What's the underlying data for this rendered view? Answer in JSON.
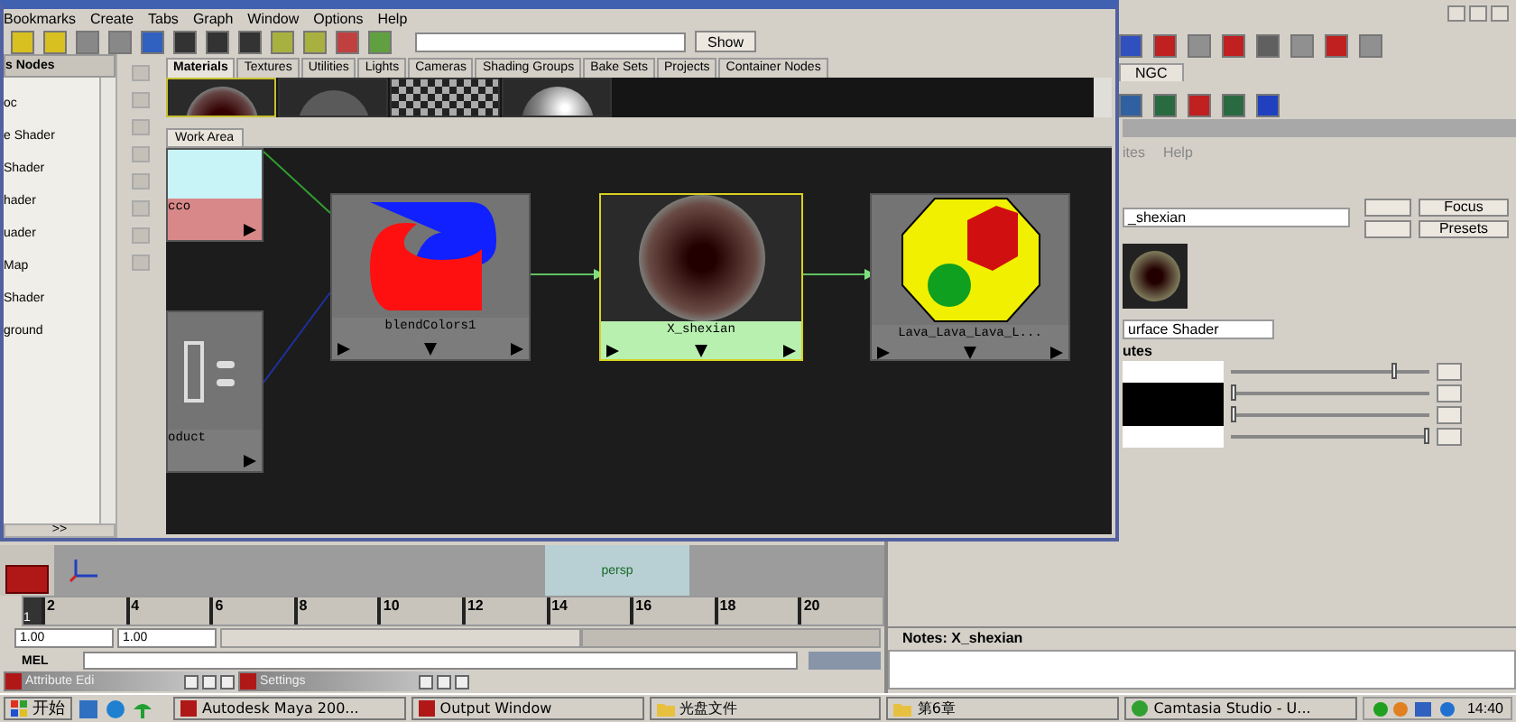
{
  "hypershade": {
    "menu": [
      "Bookmarks",
      "Create",
      "Tabs",
      "Graph",
      "Window",
      "Options",
      "Help"
    ],
    "show_button": "Show",
    "node_panel": {
      "header": "s Nodes",
      "items": [
        "oc",
        "e Shader",
        "Shader",
        "hader",
        "uader",
        "Map",
        "Shader",
        "ground"
      ],
      "more_button": ">>"
    },
    "tabs": [
      {
        "label": "Materials",
        "selected": true
      },
      {
        "label": "Textures",
        "selected": false
      },
      {
        "label": "Utilities",
        "selected": false
      },
      {
        "label": "Lights",
        "selected": false
      },
      {
        "label": "Cameras",
        "selected": false
      },
      {
        "label": "Shading Groups",
        "selected": false
      },
      {
        "label": "Bake Sets",
        "selected": false
      },
      {
        "label": "Projects",
        "selected": false
      },
      {
        "label": "Container Nodes",
        "selected": false
      }
    ],
    "swatches": [
      {
        "kind": "ring",
        "selected": true
      },
      {
        "kind": "matte",
        "selected": false
      },
      {
        "kind": "checker",
        "selected": false
      },
      {
        "kind": "chrome",
        "selected": false
      }
    ],
    "work_area_tab": "Work Area",
    "nodes": [
      {
        "label": "cco",
        "kind": "texture",
        "selected": false
      },
      {
        "label": "oduct",
        "kind": "utility",
        "selected": false
      },
      {
        "label": "blendColors1",
        "kind": "blend",
        "selected": false
      },
      {
        "label": "X_shexian",
        "kind": "shader",
        "selected": true
      },
      {
        "label": "Lava_Lava_Lava_L...",
        "kind": "group",
        "selected": false
      }
    ]
  },
  "shelf": {
    "tab": "NGC"
  },
  "attribute_editor": {
    "menu": [
      "ites",
      "Help"
    ],
    "name_field": "_shexian",
    "buttons": [
      "Focus",
      "Presets"
    ],
    "type_dropdown": "urface Shader",
    "section": "utes",
    "rows": [
      {
        "color": "#ffffff",
        "level": 0.83
      },
      {
        "color": "#000000",
        "level": 0.02
      },
      {
        "color": "#000000",
        "level": 0.02
      },
      {
        "color": "#ffffff",
        "level": 0.99
      }
    ],
    "notes_label": "Notes:  X_shexian"
  },
  "viewport": {
    "camera": "persp"
  },
  "timeline": {
    "ticks": [
      "2",
      "4",
      "6",
      "8",
      "10",
      "12",
      "14",
      "16",
      "18",
      "20"
    ],
    "current_frame": "1",
    "start": "1.00",
    "end": "1.00",
    "range": {
      "level": 0.55
    }
  },
  "command_line": {
    "label": "MEL"
  },
  "minimized_windows": [
    "Attribute Edi",
    "Settings"
  ],
  "taskbar": {
    "start": "开始",
    "items": [
      {
        "label": "Autodesk Maya 200...",
        "kind": "app"
      },
      {
        "label": "Output Window",
        "kind": "app"
      },
      {
        "label": "光盘文件",
        "kind": "folder"
      },
      {
        "label": "第6章",
        "kind": "folder"
      },
      {
        "label": "Camtasia Studio - U...",
        "kind": "camtasia"
      }
    ],
    "clock": "14:40"
  }
}
